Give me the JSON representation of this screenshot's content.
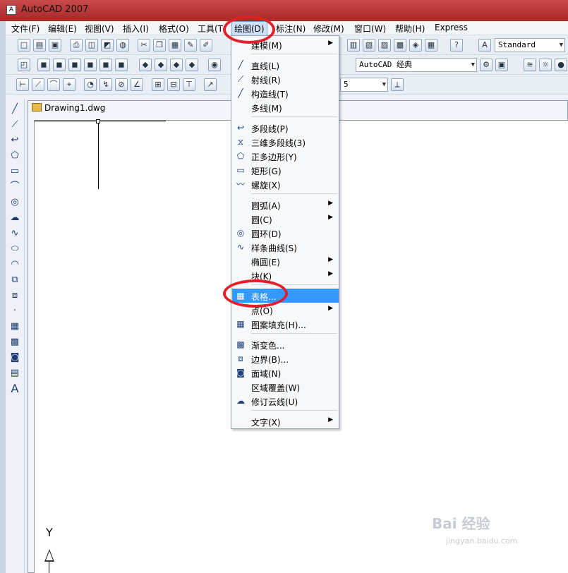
{
  "window": {
    "title": "AutoCAD 2007",
    "app_icon": "autocad-icon"
  },
  "menubar": {
    "items": [
      {
        "label": "文件(F)"
      },
      {
        "label": "编辑(E)"
      },
      {
        "label": "视图(V)"
      },
      {
        "label": "插入(I)"
      },
      {
        "label": "格式(O)"
      },
      {
        "label": "工具(T"
      },
      {
        "label": "绘图(D)"
      },
      {
        "label": "标注(N)"
      },
      {
        "label": "修改(M)"
      },
      {
        "label": "窗口(W)"
      },
      {
        "label": "帮助(H)"
      },
      {
        "label": "Express"
      }
    ]
  },
  "toolbars": {
    "text_style": "Standard",
    "workspace": "AutoCAD 经典",
    "lineweight_value": "5"
  },
  "document": {
    "tab_title": "Drawing1.dwg"
  },
  "ucs": {
    "y_label": "Y"
  },
  "draw_menu": {
    "items": [
      {
        "label": "建模(M)",
        "icon": "",
        "submenu": true
      },
      {
        "label": "直线(L)",
        "icon": "line-icon",
        "submenu": false
      },
      {
        "label": "射线(R)",
        "icon": "ray-icon",
        "submenu": false
      },
      {
        "label": "构造线(T)",
        "icon": "xline-icon",
        "submenu": false
      },
      {
        "label": "多线(M)",
        "icon": "",
        "submenu": false
      },
      {
        "label": "多段线(P)",
        "icon": "polyline-icon",
        "submenu": false
      },
      {
        "label": "三维多段线(3)",
        "icon": "3dpolyline-icon",
        "submenu": false
      },
      {
        "label": "正多边形(Y)",
        "icon": "polygon-icon",
        "submenu": false
      },
      {
        "label": "矩形(G)",
        "icon": "rectangle-icon",
        "submenu": false
      },
      {
        "label": "螺旋(X)",
        "icon": "helix-icon",
        "submenu": false
      },
      {
        "label": "圆弧(A)",
        "icon": "",
        "submenu": true
      },
      {
        "label": "圆(C)",
        "icon": "",
        "submenu": true
      },
      {
        "label": "圆环(D)",
        "icon": "donut-icon",
        "submenu": false
      },
      {
        "label": "样条曲线(S)",
        "icon": "spline-icon",
        "submenu": false
      },
      {
        "label": "椭圆(E)",
        "icon": "",
        "submenu": true
      },
      {
        "label": "块(K)",
        "icon": "",
        "submenu": true
      },
      {
        "label": "表格...",
        "icon": "table-icon",
        "submenu": false,
        "highlighted": true
      },
      {
        "label": "点(O)",
        "icon": "",
        "submenu": true
      },
      {
        "label": "图案填充(H)...",
        "icon": "hatch-icon",
        "submenu": false
      },
      {
        "label": "渐变色...",
        "icon": "gradient-icon",
        "submenu": false
      },
      {
        "label": "边界(B)...",
        "icon": "boundary-icon",
        "submenu": false
      },
      {
        "label": "面域(N)",
        "icon": "region-icon",
        "submenu": false
      },
      {
        "label": "区域覆盖(W)",
        "icon": "",
        "submenu": false
      },
      {
        "label": "修订云线(U)",
        "icon": "revcloud-icon",
        "submenu": false
      },
      {
        "label": "文字(X)",
        "icon": "",
        "submenu": true
      }
    ]
  },
  "watermark": {
    "text": "Bai 经验",
    "sub": "jingyan.baidu.com"
  },
  "colors": {
    "highlight": "#3399ff",
    "annotation_ring": "#e0202a",
    "titlebar": "#b83333"
  }
}
